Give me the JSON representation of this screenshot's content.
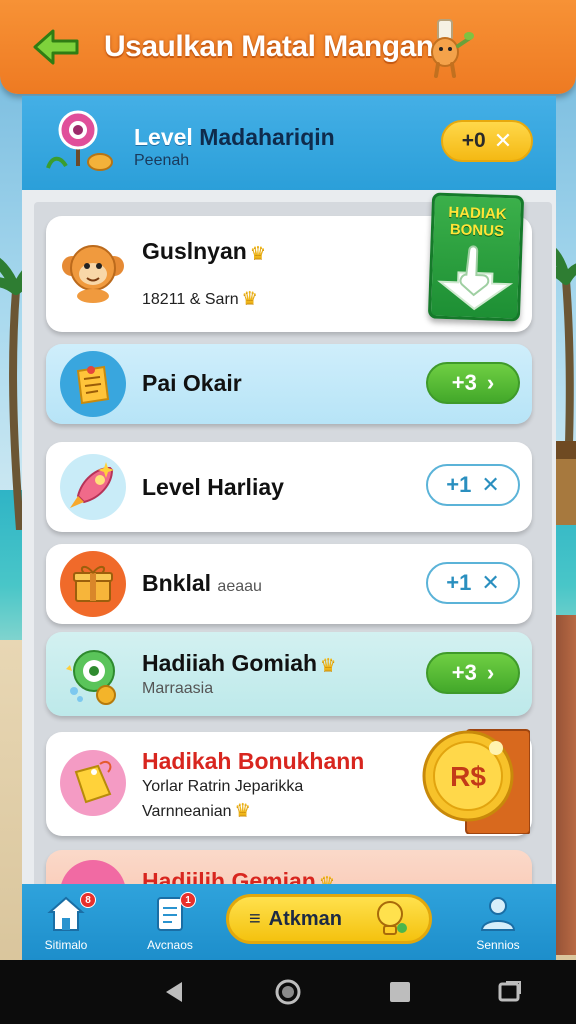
{
  "header": {
    "title": "Usaulkan Matal Mangan"
  },
  "level": {
    "title_part1": "Level",
    "title_part2": "Madahariqin",
    "subtitle": "Peenah",
    "pill_value": "+0"
  },
  "bonus_badge": {
    "line1": "HADIAK",
    "line2": "BONUS"
  },
  "cards": [
    {
      "title": "Guslnyan",
      "subtitle": "18211 & Sarn",
      "style": "white"
    },
    {
      "title": "Pai Okair",
      "pill": "+3",
      "style": "blue"
    },
    {
      "title": "Level Harliay",
      "pill": "+1",
      "style": "white"
    },
    {
      "title": "Bnklal",
      "subtitle": "aeaau",
      "pill": "+1",
      "style": "white"
    },
    {
      "title": "Hadiiah Gomiah",
      "subtitle": "Marraasia",
      "pill": "+3",
      "style": "teal"
    },
    {
      "title": "Hadikah Bonukhann",
      "subtitle": "Yorlar Ratrin Jeparikka",
      "subtitle2": "Varnneanian",
      "coin_text": "R$",
      "style": "white"
    },
    {
      "title": "Hadiilih Gemian",
      "style": "peach"
    }
  ],
  "bottom_nav": {
    "items": [
      {
        "label": "Sitimalo",
        "badge": "8",
        "icon": "home-icon"
      },
      {
        "label": "Avcnaos",
        "badge": "1",
        "icon": "clipboard-icon"
      },
      {
        "label": "Sennios",
        "icon": "user-icon"
      }
    ],
    "action_label": "Atkman"
  },
  "colors": {
    "header_orange": "#ee7a22",
    "panel_blue": "#2b9fd9",
    "pill_green": "#43a82a",
    "pill_yellow": "#f4b914",
    "title_red": "#d8261f"
  }
}
